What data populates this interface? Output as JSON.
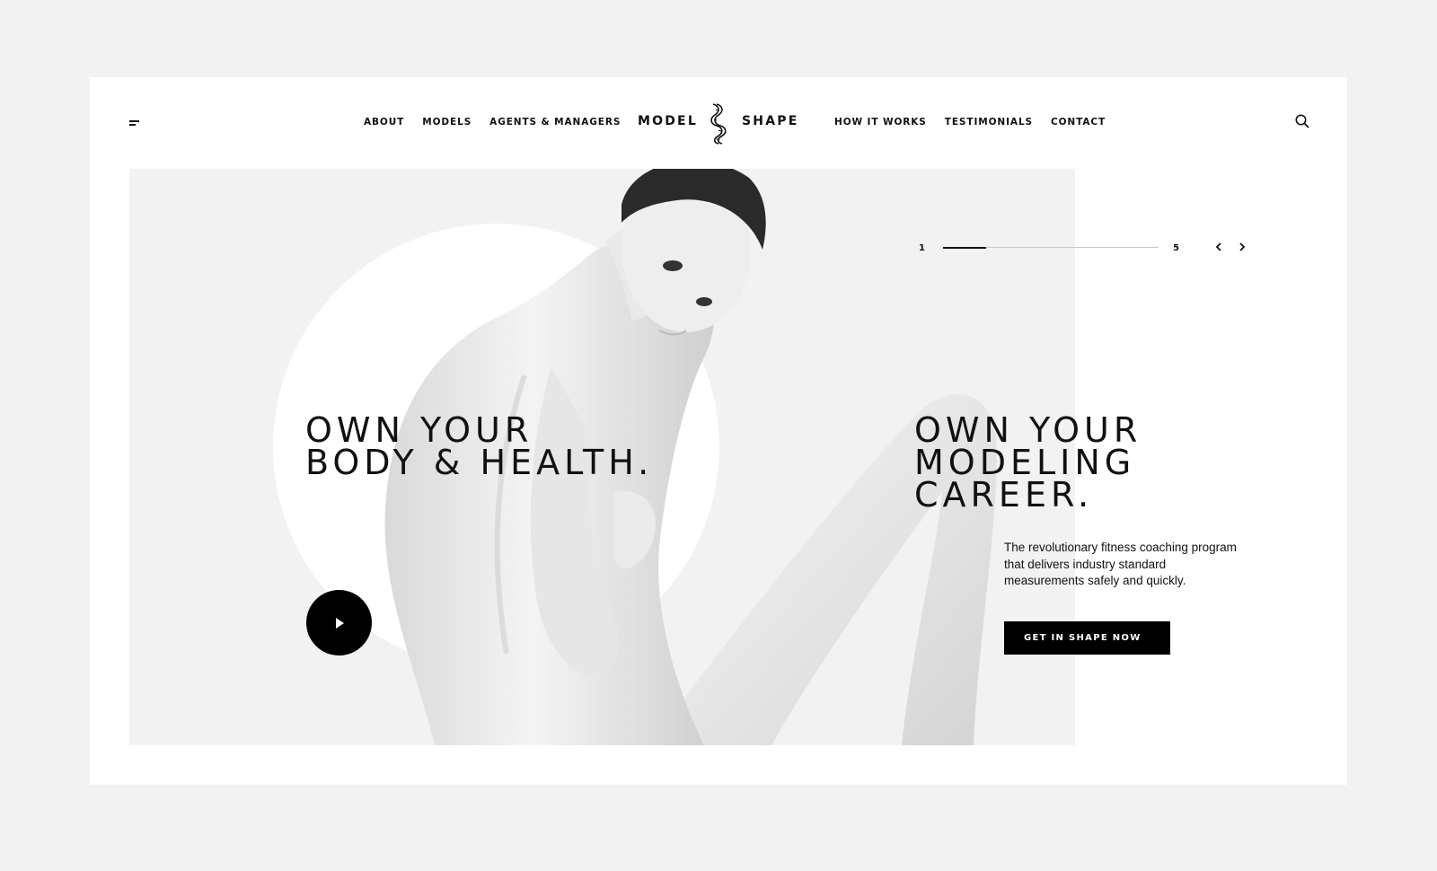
{
  "brand": {
    "name_left": "MODEL",
    "name_right": "SHAPE",
    "logo_icon": "measuring-tape-icon"
  },
  "nav": {
    "left": [
      {
        "label": "ABOUT"
      },
      {
        "label": "MODELS"
      },
      {
        "label": "AGENTS & MANAGERS"
      }
    ],
    "right": [
      {
        "label": "HOW IT WORKS"
      },
      {
        "label": "TESTIMONIALS"
      },
      {
        "label": "CONTACT"
      }
    ]
  },
  "header": {
    "menu_icon": "hamburger-menu-icon",
    "search_icon": "search-icon"
  },
  "hero": {
    "headline_left": "OWN YOUR\nBODY & HEALTH.",
    "headline_right": "OWN YOUR\nMODELING\nCAREER.",
    "description": "The revolutionary fitness coaching program that delivers industry standard measurements safely and quickly.",
    "cta_label": "GET IN SHAPE NOW",
    "play_icon": "play-icon"
  },
  "slider": {
    "current": "1",
    "total": "5",
    "progress": 0.2,
    "prev_icon": "chevron-left-icon",
    "next_icon": "chevron-right-icon"
  },
  "colors": {
    "page_background": "#f2f2f2",
    "card_background": "#ffffff",
    "hero_background": "#f2f2f2",
    "primary": "#000000",
    "text": "#111111"
  }
}
